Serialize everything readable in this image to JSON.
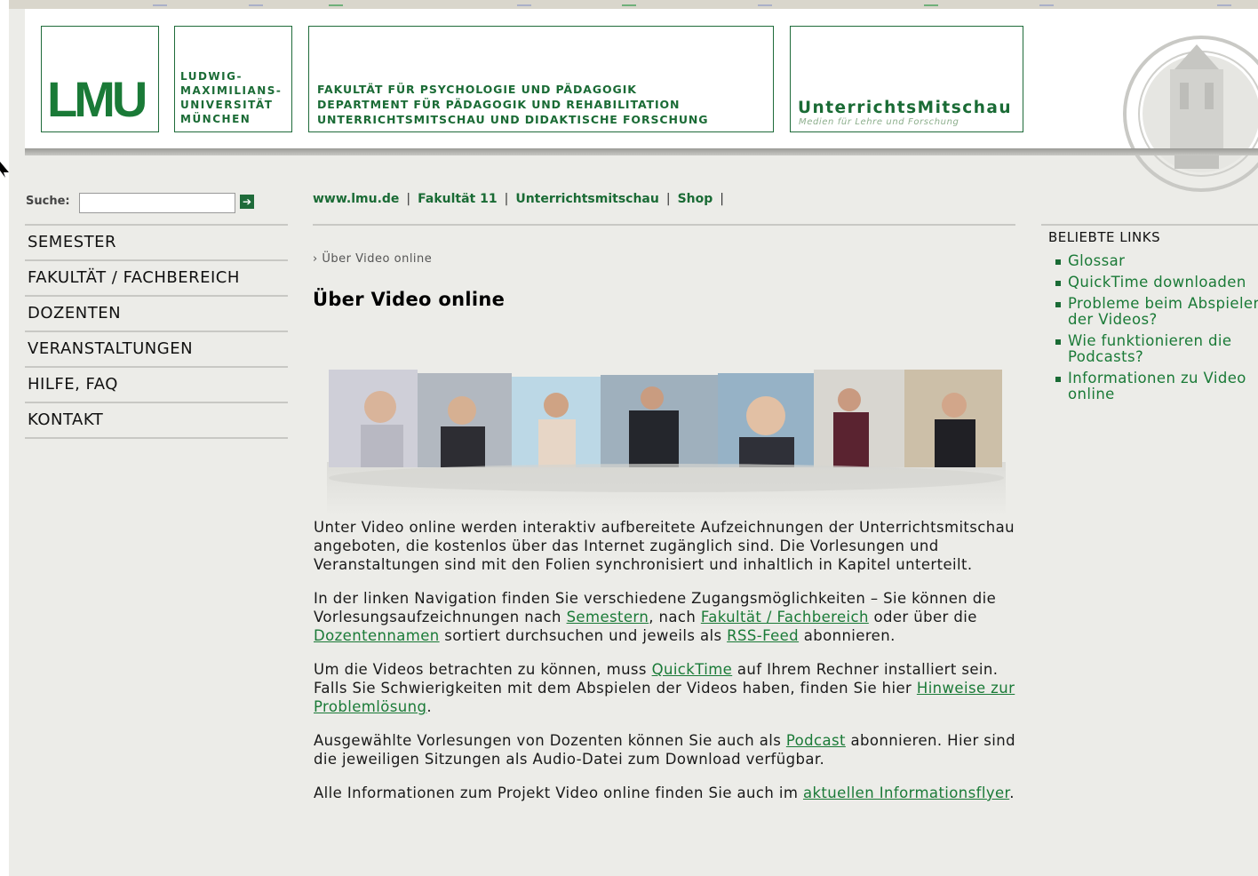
{
  "header": {
    "lmu_logo": "LMU",
    "university_lines": [
      "LUDWIG-",
      "MAXIMILIANS-",
      "UNIVERSITÄT",
      "MÜNCHEN"
    ],
    "faculty_lines": [
      "FAKULTÄT FÜR PSYCHOLOGIE UND PÄDAGOGIK",
      "DEPARTMENT FÜR PÄDAGOGIK UND REHABILITATION",
      "UNTERRICHTSMITSCHAU UND DIDAKTISCHE FORSCHUNG"
    ],
    "brand_title": "UnterrichtsMitschau",
    "brand_subtitle": "Medien für Lehre und Forschung"
  },
  "search": {
    "label": "Suche:",
    "value": "",
    "go_icon": "arrow-right-icon"
  },
  "leftnav": {
    "items": [
      {
        "label": "SEMESTER"
      },
      {
        "label": "FAKULTÄT / FACHBEREICH"
      },
      {
        "label": "DOZENTEN"
      },
      {
        "label": "VERANSTALTUNGEN"
      },
      {
        "label": "HILFE, FAQ"
      },
      {
        "label": "KONTAKT"
      }
    ]
  },
  "topnav": {
    "items": [
      {
        "label": "www.lmu.de"
      },
      {
        "label": "Fakultät 11"
      },
      {
        "label": "Unterrichtsmitschau"
      },
      {
        "label": "Shop"
      }
    ],
    "separator": "|"
  },
  "main": {
    "breadcrumb": "› Über Video online",
    "title": "Über Video online",
    "p1": "Unter Video online werden interaktiv aufbereitete Aufzeichnungen der Unterrichtsmitschau angeboten, die kostenlos über das Internet zugänglich sind. Die Vorlesungen und Veranstaltungen sind mit den Folien synchronisiert und inhaltlich in Kapitel unterteilt.",
    "p2": {
      "t1": "In der linken Navigation finden Sie verschiedene Zugangsmöglichkeiten – Sie können die Vorlesungsaufzeichnungen nach ",
      "l1": "Semestern",
      "t2": ", nach ",
      "l2": "Fakultät / Fachbereich",
      "t3": " oder über die ",
      "l3": "Dozentennamen",
      "t4": " sortiert durchsuchen und jeweils als ",
      "l4": "RSS-Feed",
      "t5": " abonnieren."
    },
    "p3": {
      "t1": "Um die Videos betrachten zu können, muss ",
      "l1": "QuickTime",
      "t2": " auf Ihrem Rechner installiert sein. Falls Sie Schwierigkeiten mit dem Abspielen der Videos haben, finden Sie hier ",
      "l2": "Hinweise zur Problemlösung",
      "t3": "."
    },
    "p4": {
      "t1": "Ausgewählte Vorlesungen von Dozenten können Sie auch als ",
      "l1": "Podcast",
      "t2": " abonnieren. Hier sind die jeweiligen Sitzungen als Audio-Datei zum Download verfügbar."
    },
    "p5": {
      "t1": "Alle Informationen zum Projekt Video online finden Sie auch im ",
      "l1": "aktuellen Informationsflyer",
      "t2": "."
    }
  },
  "sidebar": {
    "title": "BELIEBTE LINKS",
    "links": [
      {
        "label": "Glossar"
      },
      {
        "label": "QuickTime downloaden"
      },
      {
        "label": "Probleme beim Abspielen der Videos?"
      },
      {
        "label": "Wie funktionieren die Podcasts?"
      },
      {
        "label": "Informationen zu Video online"
      }
    ]
  },
  "colors": {
    "brand_green": "#1a6b35",
    "link_green": "#1a7a37",
    "background": "#ecece8"
  }
}
